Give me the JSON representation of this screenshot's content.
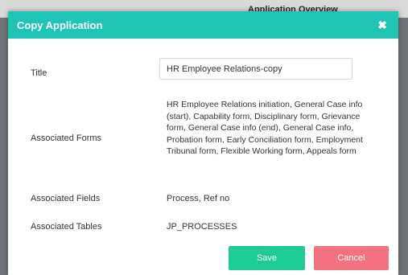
{
  "background": {
    "page_title": "Application Overview"
  },
  "dialog": {
    "title": "Copy Application",
    "close_symbol": "✖",
    "fields": {
      "title_label": "Title",
      "title_value": "HR Employee Relations-copy",
      "forms_label": "Associated Forms",
      "forms_value": "HR Employee Relations initiation, General Case info (start), Capability form, Disciplinary form, Grievance form, General Case info (end), General Case info, Probation form, Early Conciliation form, Employment Tribunal form, Flexible Working form, Appeals form",
      "fields_label": "Associated Fields",
      "fields_value": "Process, Ref no",
      "tables_label": "Associated Tables",
      "tables_value": "JP_PROCESSES"
    },
    "buttons": {
      "save": "Save",
      "cancel": "Cancel"
    }
  },
  "colors": {
    "header": "#20c4b5",
    "save": "#1fcb94",
    "cancel": "#f2727f"
  }
}
